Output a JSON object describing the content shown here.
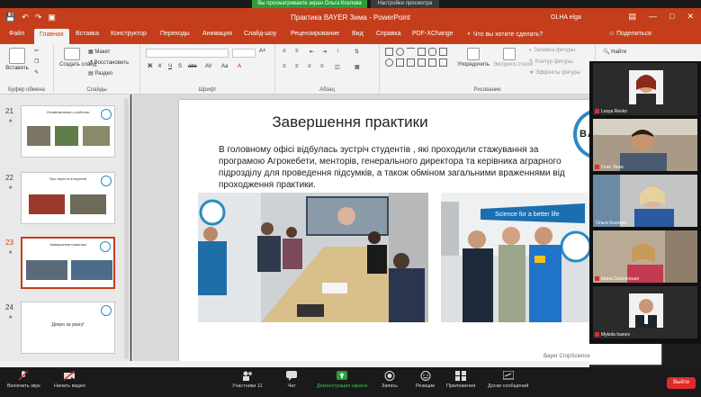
{
  "share": {
    "status": "Вы просматриваете экран Ольга Козлова",
    "options": "Настройки просмотра"
  },
  "titlebar": {
    "doc_title": "Практика BAYER Зима  -  PowerPoint",
    "user": "OLHA elga",
    "qat_icons": [
      "save-icon",
      "undo-icon",
      "redo-icon",
      "present-icon"
    ]
  },
  "tabs": {
    "items": [
      "Файл",
      "Главная",
      "Вставка",
      "Конструктор",
      "Переходы",
      "Анимация",
      "Слайд-шоу",
      "Рецензирование",
      "Вид",
      "Справка",
      "PDF-XChange"
    ],
    "active": "Главная",
    "tell_me": "Что вы хотите сделать?",
    "share": "Поделиться"
  },
  "ribbon": {
    "clipboard": {
      "paste": "Вставить",
      "label": "Буфер обмена"
    },
    "slides": {
      "new_slide": "Создать слайд",
      "layout": "Макет",
      "reset": "Восстановить",
      "section": "Раздел",
      "label": "Слайды"
    },
    "font": {
      "label": "Шрифт"
    },
    "paragraph": {
      "label": "Абзац"
    },
    "drawing": {
      "arrange": "Упорядочить",
      "quick_styles": "Экспресс-стили",
      "fill": "Заливка фигуры",
      "outline": "Контур фигуры",
      "effects": "Эффекты фигуры",
      "label": "Рисование"
    },
    "editing": {
      "find": "Найти"
    }
  },
  "slides_panel": [
    {
      "num": "21",
      "title": "Ознайомлення з роботою"
    },
    {
      "num": "22",
      "title": "Про терен в алгоритмі"
    },
    {
      "num": "23",
      "title": "Завершення практики"
    },
    {
      "num": "24",
      "title": "Дякую за увагу!"
    }
  ],
  "slide": {
    "title": "Завершення практики",
    "body": "В головному офісі відбулась зустріч студентів , які проходили стажування за програмою Агрокебети, менторів, генерального директора та керівника аграрного підрозділу для проведення підсумків, а також обміном загальними враженнями від проходження практики.",
    "logo": "BAYER",
    "footer": "Bayer CropScience",
    "banner": "Science for a better life"
  },
  "participants": [
    {
      "name": "Lesya Revko",
      "muted": true
    },
    {
      "name": "Олег Зінка",
      "muted": true
    },
    {
      "name": "Ольга Козлова",
      "muted": false
    },
    {
      "name": "Ірина Скоплюсько",
      "muted": true
    },
    {
      "name": "Mykola Ivanov",
      "muted": true
    }
  ],
  "zoom_toolbar": {
    "mute": "Включить звук",
    "video": "Начать видео",
    "participants": "Участники",
    "participants_count": "11",
    "chat": "Чат",
    "share": "Демонстрация экрана",
    "record": "Запись",
    "reactions": "Реакции",
    "apps": "Приложения",
    "whiteboard": "Доски сообщений",
    "end": "Выйти"
  }
}
